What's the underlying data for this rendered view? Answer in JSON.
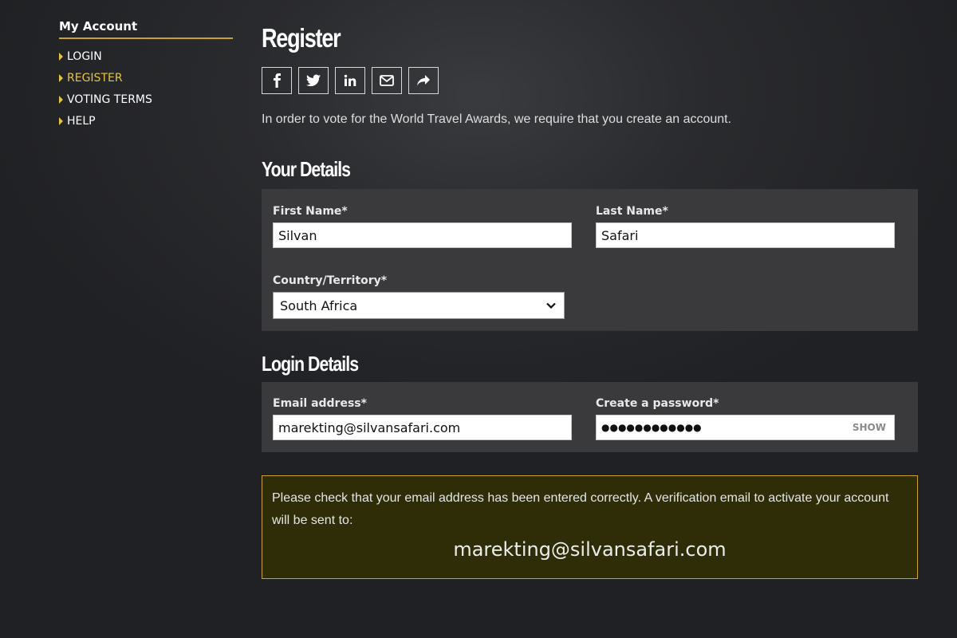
{
  "sidebar": {
    "heading": "My Account",
    "items": [
      {
        "label": "LOGIN",
        "active": false
      },
      {
        "label": "REGISTER",
        "active": true
      },
      {
        "label": "VOTING TERMS",
        "active": false
      },
      {
        "label": "HELP",
        "active": false
      }
    ]
  },
  "main": {
    "title": "Register",
    "share_icons": [
      "facebook-icon",
      "twitter-icon",
      "linkedin-icon",
      "email-icon",
      "share-icon"
    ],
    "intro": "In order to vote for the World Travel Awards, we require that you create an account.",
    "your_details": {
      "title": "Your Details",
      "first_name": {
        "label": "First Name*",
        "value": "Silvan"
      },
      "last_name": {
        "label": "Last Name*",
        "value": "Safari"
      },
      "country": {
        "label": "Country/Territory*",
        "value": "South Africa"
      }
    },
    "login_details": {
      "title": "Login Details",
      "email": {
        "label": "Email address*",
        "value": "marekting@silvansafari.com"
      },
      "password": {
        "label": "Create a password*",
        "value": "●●●●●●●●●●●●",
        "toggle": "SHOW"
      }
    },
    "notice": {
      "text": "Please check that your email address has been entered correctly. A verification email to activate your account will be sent to:",
      "email": "marekting@silvansafari.com"
    }
  },
  "colors": {
    "accent": "#c9a227",
    "active_nav": "#e5c43f",
    "panel_bg": "#3a3a3c",
    "notice_bg": "#2e2d08",
    "page_bg": "#202124"
  }
}
